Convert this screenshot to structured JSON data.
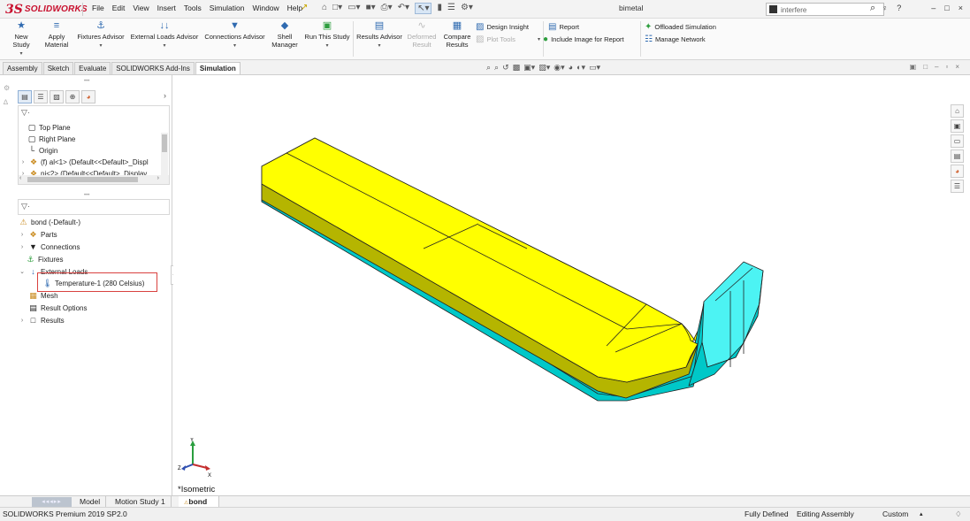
{
  "app": {
    "logo_prefix": "3S",
    "logo_brand": "SOLIDWORKS",
    "document_title": "bimetal",
    "window_controls": [
      "–",
      "□",
      "×"
    ]
  },
  "menu": [
    "File",
    "Edit",
    "View",
    "Insert",
    "Tools",
    "Simulation",
    "Window",
    "Help"
  ],
  "search": {
    "value": "interfere",
    "placeholder": ""
  },
  "help_icons": [
    "♀",
    "?",
    "–",
    "□",
    "×"
  ],
  "ribbon": {
    "new_study": "New Study",
    "apply_material_1": "Apply",
    "apply_material_2": "Material",
    "fixtures_advisor": "Fixtures Advisor",
    "external_loads_advisor": "External Loads Advisor",
    "connections_advisor": "Connections Advisor",
    "shell_manager_1": "Shell",
    "shell_manager_2": "Manager",
    "run_this_study": "Run This Study",
    "results_advisor": "Results Advisor",
    "deformed_result_1": "Deformed",
    "deformed_result_2": "Result",
    "compare_results_1": "Compare",
    "compare_results_2": "Results",
    "design_insight": "Design Insight",
    "plot_tools": "Plot Tools",
    "report": "Report",
    "include_image": "Include Image for Report",
    "offloaded_simulation": "Offloaded Simulation",
    "manage_network": "Manage Network"
  },
  "command_tabs": [
    {
      "label": "Assembly",
      "active": false
    },
    {
      "label": "Sketch",
      "active": false
    },
    {
      "label": "Evaluate",
      "active": false
    },
    {
      "label": "SOLIDWORKS Add-Ins",
      "active": false
    },
    {
      "label": "Simulation",
      "active": true
    }
  ],
  "feature_tree": [
    {
      "label": "Top Plane",
      "icon": "plane-icon"
    },
    {
      "label": "Right Plane",
      "icon": "plane-icon"
    },
    {
      "label": "Origin",
      "icon": "origin-icon"
    },
    {
      "label": "(f) al<1> (Default<<Default>_Displ",
      "icon": "part-icon"
    },
    {
      "label": "ni<2> (Default<<Default>_Display",
      "icon": "part-icon"
    }
  ],
  "sim_tree": {
    "study": "bond (-Default-)",
    "parts": "Parts",
    "connections": "Connections",
    "fixtures": "Fixtures",
    "external_loads": "External Loads",
    "temperature": "Temperature-1 (280 Celsius)",
    "mesh": "Mesh",
    "result_options": "Result Options",
    "results": "Results"
  },
  "viewport": {
    "view_name": "*Isometric",
    "axis_x": "X",
    "axis_y": "Y",
    "axis_z": "Z",
    "colors": {
      "top": "#ffff00",
      "side_top": "#b5b500",
      "side_bottom": "#00c8c8",
      "face_cyan": "#4cf3f3"
    }
  },
  "bottom_tabs": [
    {
      "label": "Model",
      "active": false
    },
    {
      "label": "Motion Study 1",
      "active": false
    },
    {
      "label": "bond",
      "active": true
    }
  ],
  "status": {
    "version": "SOLIDWORKS Premium 2019 SP2.0",
    "defined": "Fully Defined",
    "mode": "Editing Assembly",
    "units": "Custom"
  }
}
